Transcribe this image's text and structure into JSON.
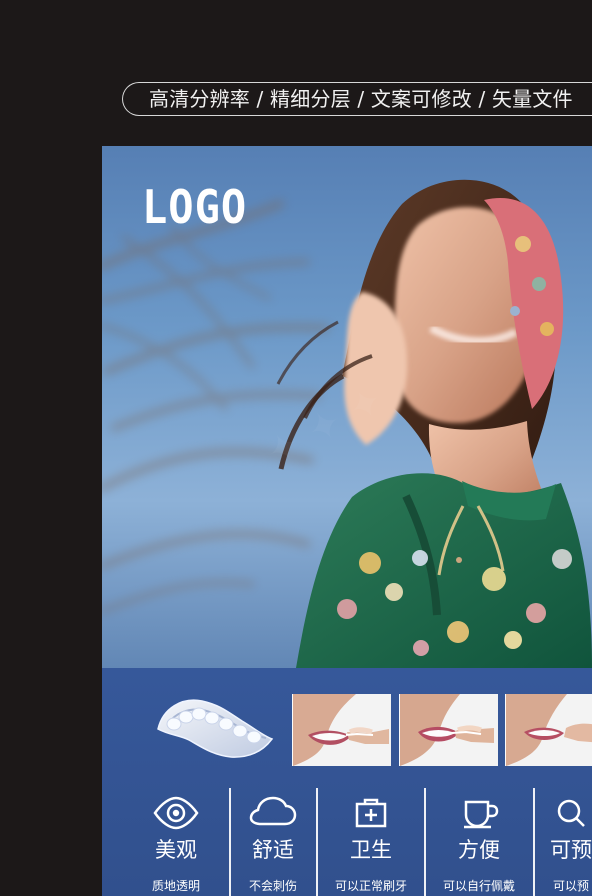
{
  "top_banner": {
    "text": "高清分辨率 / 精细分层 / 文案可修改 / 矢量文件"
  },
  "poster": {
    "logo_text": "LOGO",
    "hero_image": "woman-laughing-headscarf-floral-shirt",
    "product_image": "clear-aligner-tray",
    "smile_images": [
      "smile-with-aligner-1",
      "smile-with-aligner-2",
      "smile-with-aligner-3"
    ],
    "features": [
      {
        "icon": "eye-icon",
        "title": "美观",
        "subtitle": "质地透明"
      },
      {
        "icon": "cloud-icon",
        "title": "舒适",
        "subtitle": "不会刺伤"
      },
      {
        "icon": "medical-kit-icon",
        "title": "卫生",
        "subtitle": "可以正常刷牙"
      },
      {
        "icon": "cup-icon",
        "title": "方便",
        "subtitle": "可以自行佩戴"
      },
      {
        "icon": "search-icon",
        "title": "可预",
        "subtitle": "可以预"
      }
    ],
    "colors": {
      "background": "#1c1818",
      "strip": "#34569a",
      "text": "#ffffff"
    }
  }
}
